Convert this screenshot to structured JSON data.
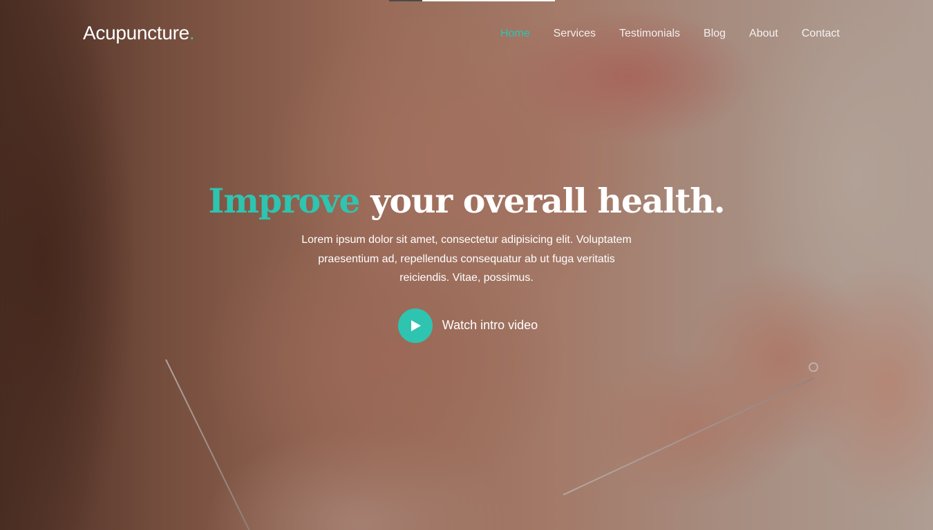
{
  "brand": {
    "name": "Acupuncture",
    "dot": ".",
    "accent_color": "#2ec4b0"
  },
  "nav": {
    "items": [
      {
        "label": "Home",
        "active": true
      },
      {
        "label": "Services",
        "active": false
      },
      {
        "label": "Testimonials",
        "active": false
      },
      {
        "label": "Blog",
        "active": false
      },
      {
        "label": "About",
        "active": false
      },
      {
        "label": "Contact",
        "active": false
      }
    ]
  },
  "hero": {
    "headline_accent": "Improve",
    "headline_rest": " your overall health.",
    "lead": "Lorem ipsum dolor sit amet, consectetur adipisicing elit. Voluptatem praesentium ad, repellendus consequatur ab ut fuga veritatis reiciendis. Vitae, possimus.",
    "video_label": "Watch intro video",
    "play_icon": "play-icon"
  }
}
